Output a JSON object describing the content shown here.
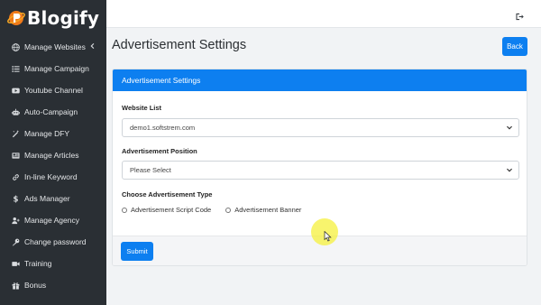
{
  "app": {
    "name": "Blogify"
  },
  "sidebar": {
    "items": [
      {
        "label": "Manage Websites",
        "icon": "globe-icon",
        "has_caret": true
      },
      {
        "label": "Manage Campaign",
        "icon": "list-icon"
      },
      {
        "label": "Youtube Channel",
        "icon": "youtube-icon"
      },
      {
        "label": "Auto-Campaign",
        "icon": "robot-icon"
      },
      {
        "label": "Manage DFY",
        "icon": "magic-wand-icon"
      },
      {
        "label": "Manage Articles",
        "icon": "newspaper-icon"
      },
      {
        "label": "In-line Keyword",
        "icon": "link-icon"
      },
      {
        "label": "Ads Manager",
        "icon": "dollar-icon"
      },
      {
        "label": "Manage Agency",
        "icon": "user-plus-icon"
      },
      {
        "label": "Change password",
        "icon": "key-icon"
      },
      {
        "label": "Training",
        "icon": "video-icon"
      },
      {
        "label": "Bonus",
        "icon": "gift-icon"
      }
    ]
  },
  "header": {
    "title": "Advertisement Settings",
    "back_label": "Back"
  },
  "card": {
    "title": "Advertisement Settings",
    "website_list": {
      "label": "Website List",
      "value": "demo1.softstrem.com"
    },
    "ad_position": {
      "label": "Advertisement Position",
      "value": "Please Select"
    },
    "ad_type": {
      "label": "Choose Advertisement Type",
      "options": [
        "Advertisement Script Code",
        "Advertisement Banner"
      ]
    },
    "submit_label": "Submit"
  },
  "colors": {
    "accent": "#0d7ff0",
    "sidebar_bg": "#2a2f34",
    "logo_orange": "#f07a1a"
  }
}
